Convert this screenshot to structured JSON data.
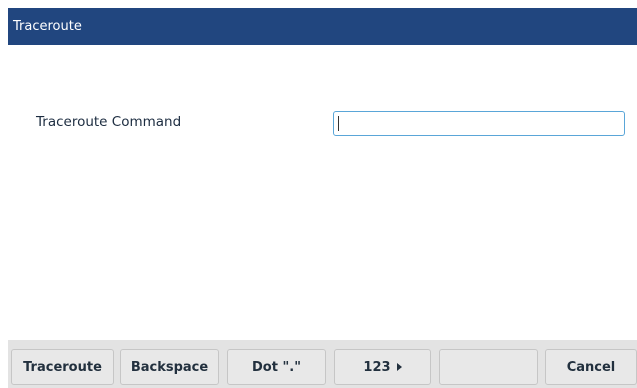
{
  "window": {
    "title": "Traceroute"
  },
  "form": {
    "label": "Traceroute Command",
    "value": "",
    "placeholder": ""
  },
  "softkeys": [
    {
      "label": "Traceroute"
    },
    {
      "label": "Backspace"
    },
    {
      "label": "Dot \".\""
    },
    {
      "label": "123",
      "icon": "arrow-right-icon"
    },
    {
      "label": ""
    },
    {
      "label": "Cancel"
    }
  ],
  "colors": {
    "title_bar": "#21467f",
    "input_border": "#5aa6d8",
    "softkey_bar": "#e3e3e3"
  }
}
